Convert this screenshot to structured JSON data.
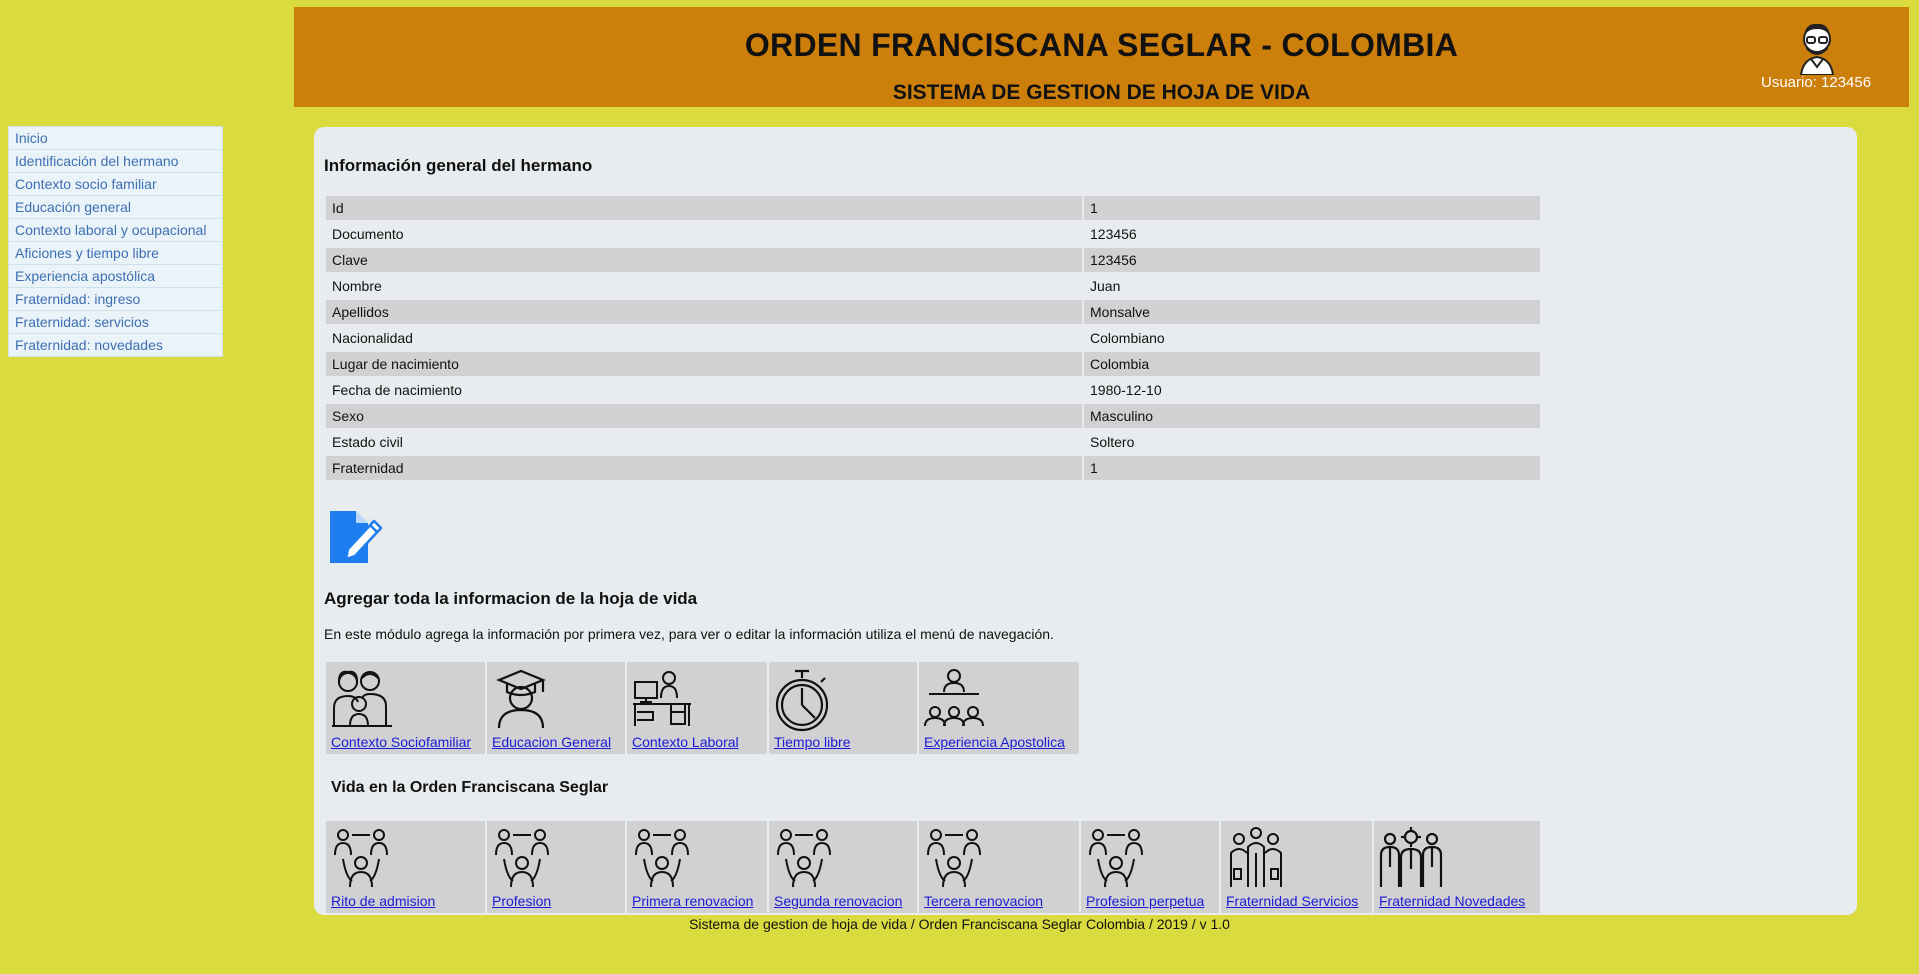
{
  "header": {
    "title": "ORDEN FRANCISCANA SEGLAR - COLOMBIA",
    "subtitle": "SISTEMA DE GESTION DE HOJA DE VIDA",
    "user_label": "Usuario: 123456",
    "avatar_icon": "user-avatar-icon"
  },
  "sidebar": {
    "items": [
      {
        "label": "Inicio"
      },
      {
        "label": "Identificación del hermano"
      },
      {
        "label": "Contexto socio familiar"
      },
      {
        "label": "Educación general"
      },
      {
        "label": "Contexto laboral y ocupacional"
      },
      {
        "label": "Aficiones y tiempo libre"
      },
      {
        "label": "Experiencia apostólica"
      },
      {
        "label": "Fraternidad: ingreso"
      },
      {
        "label": "Fraternidad: servicios"
      },
      {
        "label": "Fraternidad: novedades"
      }
    ]
  },
  "main": {
    "info_title": "Información general del hermano",
    "info_rows": [
      {
        "key": "Id",
        "value": "1"
      },
      {
        "key": "Documento",
        "value": "123456"
      },
      {
        "key": "Clave",
        "value": "123456"
      },
      {
        "key": "Nombre",
        "value": "Juan"
      },
      {
        "key": "Apellidos",
        "value": "Monsalve"
      },
      {
        "key": "Nacionalidad",
        "value": "Colombiano"
      },
      {
        "key": "Lugar de nacimiento",
        "value": "Colombia"
      },
      {
        "key": "Fecha de nacimiento",
        "value": "1980-12-10"
      },
      {
        "key": "Sexo",
        "value": "Masculino"
      },
      {
        "key": "Estado civil",
        "value": "Soltero"
      },
      {
        "key": "Fraternidad",
        "value": "1"
      }
    ],
    "edit_icon": "edit-document-icon",
    "add_title": "Agregar toda la informacion de la hoja de vida",
    "add_description": "En este módulo agrega la información por primera vez, para ver o editar la información utiliza el menú de navegación.",
    "add_cards": [
      {
        "label": "Contexto Sociofamiliar",
        "icon": "family-icon"
      },
      {
        "label": "Educacion General",
        "icon": "graduate-icon"
      },
      {
        "label": "Contexto Laboral",
        "icon": "workdesk-icon"
      },
      {
        "label": "Tiempo libre",
        "icon": "stopwatch-icon"
      },
      {
        "label": "Experiencia Apostolica",
        "icon": "teaching-icon"
      }
    ],
    "order_title": "Vida en la Orden Franciscana Seglar",
    "order_cards": [
      {
        "label": "Rito de admision",
        "icon": "group-icon"
      },
      {
        "label": "Profesion",
        "icon": "group-icon"
      },
      {
        "label": "Primera renovacion",
        "icon": "group-icon"
      },
      {
        "label": "Segunda renovacion",
        "icon": "group-icon"
      },
      {
        "label": "Tercera renovacion",
        "icon": "group-icon"
      },
      {
        "label": "Profesion perpetua",
        "icon": "group-icon"
      },
      {
        "label": "Fraternidad Servicios",
        "icon": "community-icon"
      },
      {
        "label": "Fraternidad Novedades",
        "icon": "team-icon"
      }
    ]
  },
  "footer": {
    "text": "Sistema de gestion de hoja de vida / Orden Franciscana Seglar Colombia / 2019 / v 1.0"
  }
}
